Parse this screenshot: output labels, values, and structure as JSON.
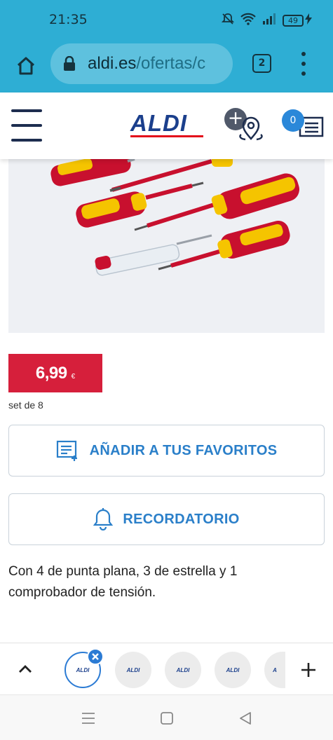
{
  "status_bar": {
    "time": "21:35",
    "battery_level": "49"
  },
  "browser": {
    "url_domain": "aldi.es",
    "url_path": "/ofertas/c",
    "tab_count": "2"
  },
  "header": {
    "logo_text": "ALDI",
    "shopping_list_count": "0"
  },
  "product": {
    "price": "6,99",
    "currency": "€",
    "unit": "set de 8",
    "favorites_label": "AÑADIR A TUS FAVORITOS",
    "reminder_label": "RECORDATORIO",
    "description": "Con 4 de punta plana, 3 de estrella y 1 comprobador de tensión."
  },
  "tab_strip": {
    "tabs": [
      {
        "logo": "ALDI",
        "active": true
      },
      {
        "logo": "ALDI",
        "active": false
      },
      {
        "logo": "ALDI",
        "active": false
      },
      {
        "logo": "ALDI",
        "active": false
      },
      {
        "logo": "A",
        "active": false
      }
    ]
  },
  "colors": {
    "chrome_blue": "#2eaed4",
    "aldi_navy": "#1b3f8c",
    "price_red": "#d61f3b",
    "action_blue": "#2a7fc9",
    "screwdriver_red": "#c8102e",
    "screwdriver_yellow": "#f5c400"
  }
}
